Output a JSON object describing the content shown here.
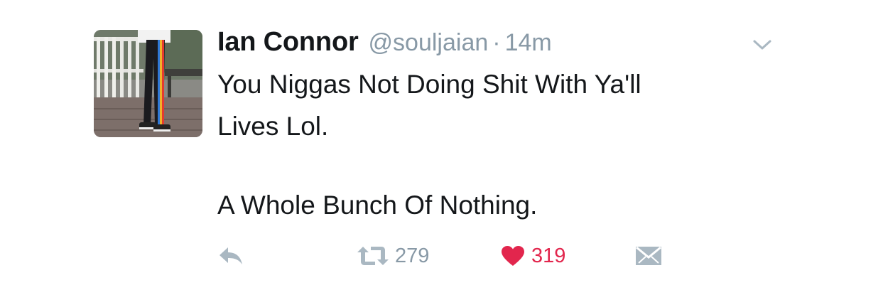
{
  "tweet": {
    "author": {
      "display_name": "Ian Connor",
      "handle": "@souljaian"
    },
    "separator": "·",
    "timestamp": "14m",
    "text_lines": [
      "You Niggas Not Doing Shit With Ya'll",
      "Lives Lol.",
      "A Whole Bunch Of Nothing."
    ],
    "actions": {
      "reply_icon": "reply-icon",
      "retweet_icon": "retweet-icon",
      "retweet_count": "279",
      "like_icon": "heart-icon",
      "like_count": "319",
      "dm_icon": "envelope-icon",
      "menu_icon": "chevron-down-icon"
    }
  },
  "colors": {
    "text": "#14171a",
    "secondary": "#8899a6",
    "like_active": "#e2264d",
    "icon": "#aab8c2"
  }
}
